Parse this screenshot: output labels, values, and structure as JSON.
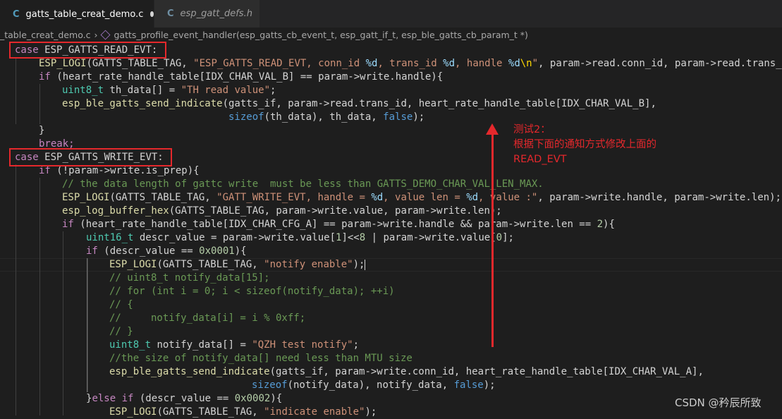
{
  "tabs": [
    {
      "icon": "C",
      "label": "gatts_table_creat_demo.c",
      "modified": true
    },
    {
      "icon": "C",
      "label": "esp_gatt_defs.h"
    }
  ],
  "breadcrumb": {
    "file": "_table_creat_demo.c",
    "symbol": "gatts_profile_event_handler(esp_gatts_cb_event_t, esp_gatt_if_t, esp_ble_gatts_cb_param_t *)"
  },
  "code": {
    "l1_case": "case",
    "l1_evt": "ESP_GATTS_READ_EVT:",
    "l2_fn": "ESP_LOGI",
    "l2_a": "(GATTS_TABLE_TAG, ",
    "l2_s1": "\"ESP_GATTS_READ_EVT, conn_id ",
    "l2_f1": "%d",
    "l2_s2": ", trans_id ",
    "l2_f2": "%d",
    "l2_s3": ", handle ",
    "l2_f3": "%d",
    "l2_esc": "\\n",
    "l2_s4": "\"",
    "l2_b": ", param->read.conn_id, param->read.trans_",
    "l3_if": "if",
    "l3_a": "(heart_rate_handle_table[IDX_CHAR_VAL_B] == param->write.handle){",
    "l4_ty": "uint8_t",
    "l4_a": " th_data[] = ",
    "l4_s": "\"TH read value\"",
    "l4_b": ";",
    "l5_fn": "esp_ble_gatts_send_indicate",
    "l5_a": "(gatts_if, param->read.trans_id, heart_rate_handle_table[IDX_CHAR_VAL_B],",
    "l6_kw": "sizeof",
    "l6_a": "(th_data), th_data, ",
    "l6_f": "false",
    "l6_b": ");",
    "l7": "}",
    "l8": "break;",
    "l9_case": "case",
    "l9_evt": "ESP_GATTS_WRITE_EVT:",
    "l10_if": "if",
    "l10_a": " (!param->write.is_prep){",
    "l11": "// the data length of gattc write  must be less than GATTS_DEMO_CHAR_VAL_LEN_MAX.",
    "l12_fn": "ESP_LOGI",
    "l12_a": "(GATTS_TABLE_TAG, ",
    "l12_s1": "\"GATT_WRITE_EVT, handle = ",
    "l12_f1": "%d",
    "l12_s2": ", value len = ",
    "l12_f2": "%d",
    "l12_s3": ", value :\"",
    "l12_b": ", param->write.handle, param->write.len);",
    "l13_fn": "esp_log_buffer_hex",
    "l13_a": "(GATTS_TABLE_TAG, param->write.value, param->write.len);",
    "l14_if": "if",
    "l14_a": " (heart_rate_handle_table[IDX_CHAR_CFG_A] == param->write.handle && param->write.len == ",
    "l14_n": "2",
    "l14_b": "){",
    "l15_ty": "uint16_t",
    "l15_a": " descr_value = param->write.value[",
    "l15_n1": "1",
    "l15_b": "]<<",
    "l15_n2": "8",
    "l15_c": " | param->write.value[",
    "l15_n3": "0",
    "l15_d": "];",
    "l16_if": "if",
    "l16_a": " (descr_value == ",
    "l16_n": "0x0001",
    "l16_b": "){",
    "l17_fn": "ESP_LOGI",
    "l17_a": "(GATTS_TABLE_TAG, ",
    "l17_s": "\"notify enable\"",
    "l17_b": ");",
    "l18": "// uint8_t notify_data[15];",
    "l19": "// for (int i = 0; i < sizeof(notify_data); ++i)",
    "l20": "// {",
    "l21": "//     notify_data[i] = i % 0xff;",
    "l22": "// }",
    "l23_ty": "uint8_t",
    "l23_a": " notify_data[] = ",
    "l23_s": "\"QZH test notify\"",
    "l23_b": ";",
    "l24": "//the size of notify_data[] need less than MTU size",
    "l25_fn": "esp_ble_gatts_send_indicate",
    "l25_a": "(gatts_if, param->write.conn_id, heart_rate_handle_table[IDX_CHAR_VAL_A],",
    "l26_kw": "sizeof",
    "l26_a": "(notify_data), notify_data, ",
    "l26_f": "false",
    "l26_b": ");",
    "l27_a": "}",
    "l27_else": "else",
    "l27_if": "if",
    "l27_b": " (descr_value == ",
    "l27_n": "0x0002",
    "l27_c": "){",
    "l28_fn": "ESP_LOGI",
    "l28_a": "(GATTS_TABLE_TAG, ",
    "l28_s": "\"indicate enable\"",
    "l28_b": ");"
  },
  "annotation": {
    "line1": "测试2：",
    "line2": "根据下面的通知方式修改上面的",
    "line3": "READ_EVT"
  },
  "watermark": "CSDN @矜辰所致",
  "colors": {
    "annotation": "#e5282c",
    "background": "#1e1e1e"
  }
}
